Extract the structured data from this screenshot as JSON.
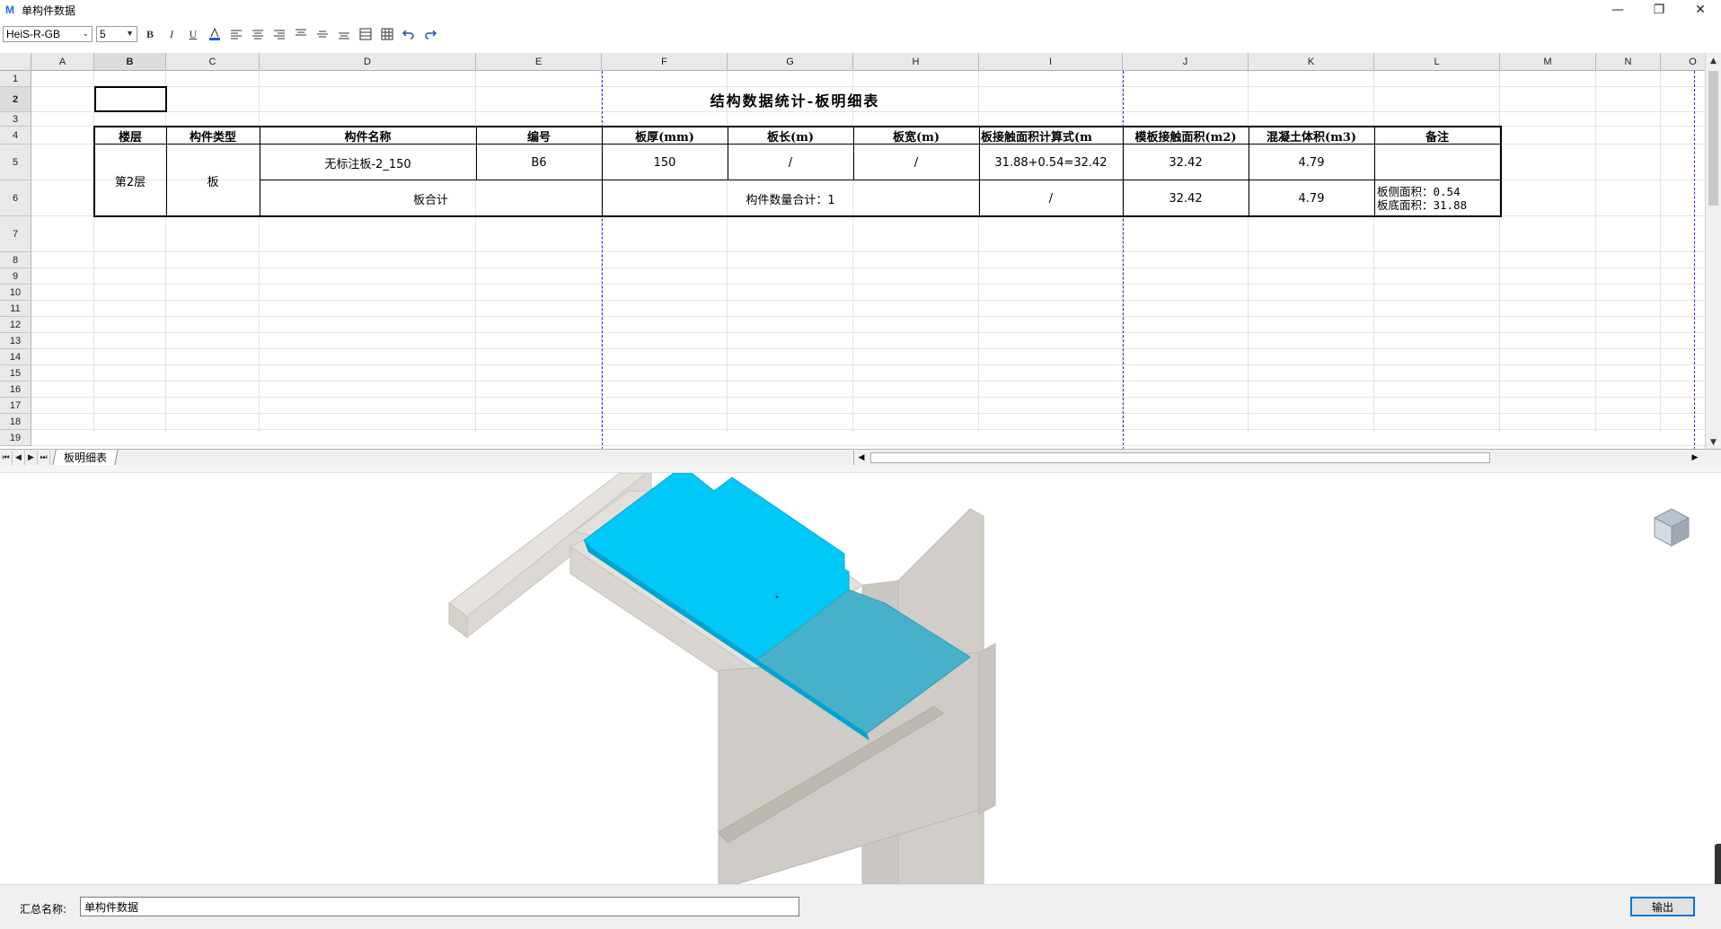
{
  "window": {
    "title": "单构件数据",
    "app_icon_glyph": "M",
    "minimize_glyph": "—",
    "restore_glyph": "❐",
    "close_glyph": "✕"
  },
  "toolbar": {
    "font_family_value": "HeiS-R-GB",
    "font_size_value": "5",
    "bold_glyph": "B",
    "italic_glyph": "I",
    "underline_glyph": "U"
  },
  "sheet": {
    "columns": [
      "A",
      "B",
      "C",
      "D",
      "E",
      "F",
      "G",
      "H",
      "I",
      "J",
      "K",
      "L",
      "M",
      "N",
      "O"
    ],
    "rows": [
      "1",
      "2",
      "3",
      "4",
      "5",
      "6",
      "7",
      "8",
      "9",
      "10",
      "11",
      "12",
      "13",
      "14",
      "15",
      "16",
      "17",
      "18",
      "19"
    ],
    "selected_column": "B",
    "selected_row": "2",
    "title": "结构数据统计-板明细表",
    "headers": [
      "楼层",
      "构件类型",
      "构件名称",
      "编号",
      "板厚(mm)",
      "板长(m)",
      "板宽(m)",
      "板接触面积计算式(m",
      "模板接触面积(m2)",
      "混凝土体积(m3)",
      "备注"
    ],
    "row5": {
      "floor": "第2层",
      "type": "板",
      "name": "无标注板-2_150",
      "code": "B6",
      "thickness": "150",
      "length": "/",
      "width": "/",
      "formula": "31.88+0.54=32.42",
      "formwork_area": "32.42",
      "volume": "4.79",
      "remark": ""
    },
    "row6": {
      "subtotal_label": "板合计",
      "count_label": "构件数量合计：1",
      "formula": "/",
      "formwork_area": "32.42",
      "volume": "4.79",
      "remark_line1": "板侧面积：0.54",
      "remark_line2": "板底面积：31.88"
    }
  },
  "tabs": {
    "active": "板明细表"
  },
  "view3d": {
    "highlight_color": "#00c8f8",
    "structure_color": "#d4d0cb",
    "viewcube_icon": "view-cube-icon"
  },
  "bottom": {
    "summary_label": "汇总名称:",
    "summary_value": "单构件数据",
    "export_label": "输出"
  }
}
